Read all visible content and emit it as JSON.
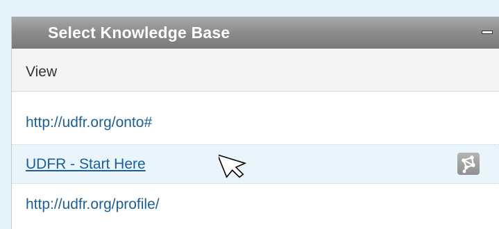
{
  "panel": {
    "title": "Select Knowledge Base",
    "view_label": "View",
    "icons": {
      "collapse": "minus-icon",
      "graph": "graph-network-icon",
      "cursor": "pointer-arrow-icon"
    }
  },
  "kb_items": [
    {
      "label": "http://udfr.org/onto#",
      "state": "normal"
    },
    {
      "label": "UDFR - Start Here",
      "state": "hover"
    },
    {
      "label": "http://udfr.org/profile/",
      "state": "normal"
    }
  ],
  "colors": {
    "link": "#1d5f94",
    "header_bg": "#8a8a8a",
    "hover_bg": "#eaf4fb",
    "page_bg": "#e4f1f9"
  }
}
